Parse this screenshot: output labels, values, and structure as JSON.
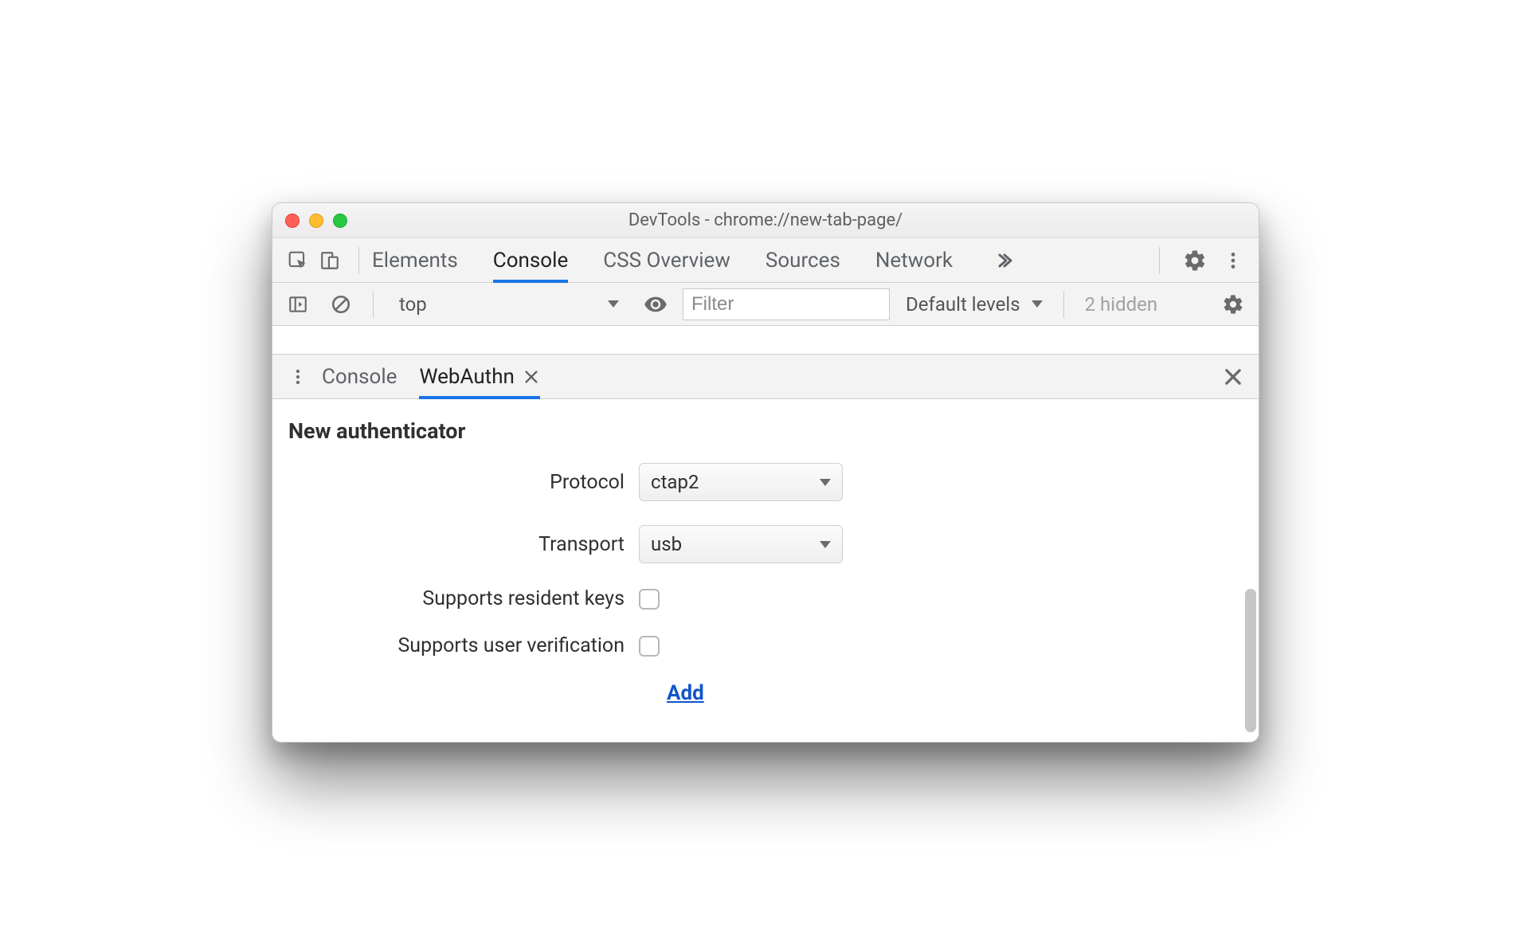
{
  "window": {
    "title": "DevTools - chrome://new-tab-page/"
  },
  "main_tabs": {
    "items": [
      "Elements",
      "Console",
      "CSS Overview",
      "Sources",
      "Network"
    ],
    "active": "Console"
  },
  "console_toolbar": {
    "context": "top",
    "filter_placeholder": "Filter",
    "levels_label": "Default levels",
    "hidden_label": "2 hidden"
  },
  "drawer": {
    "tabs": [
      "Console",
      "WebAuthn"
    ],
    "active": "WebAuthn"
  },
  "webauthn": {
    "section_title": "New authenticator",
    "rows": {
      "protocol_label": "Protocol",
      "protocol_value": "ctap2",
      "transport_label": "Transport",
      "transport_value": "usb",
      "resident_label": "Supports resident keys",
      "verification_label": "Supports user verification"
    },
    "add_label": "Add"
  }
}
